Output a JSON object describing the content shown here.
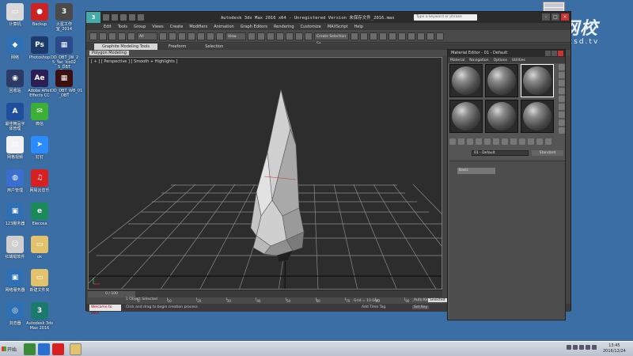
{
  "desktop": {
    "icons": [
      {
        "label": "计算机",
        "color": "#d9d9d9",
        "glyph": "▭",
        "icon": "computer-icon"
      },
      {
        "label": "Backup",
        "color": "#cc2222",
        "glyph": "●",
        "icon": "backup-icon"
      },
      {
        "label": "火星工作\n室_2014",
        "color": "#4a4a4a",
        "glyph": "3",
        "icon": "max-icon"
      },
      {
        "label": "网络",
        "color": "#2f6fb3",
        "glyph": "◆",
        "icon": "network-icon"
      },
      {
        "label": "Photoshop",
        "color": "#1c3a6b",
        "glyph": "Ps",
        "icon": "photoshop-icon"
      },
      {
        "label": "DD_DBT_JW_2\n5_Yac_Ico02\n5_DBT",
        "color": "#2a4a8a",
        "glyph": "▦",
        "icon": "image-file-icon"
      },
      {
        "label": "回收站",
        "color": "#2c3b66",
        "glyph": "◉",
        "icon": "recycle-bin-icon"
      },
      {
        "label": "Adobe After\nEffects CC",
        "color": "#2a1e55",
        "glyph": "Ae",
        "icon": "after-effects-icon"
      },
      {
        "label": "DD_DBT_WB_01\n_DBT",
        "color": "#3a1010",
        "glyph": "▦",
        "icon": "image-file-icon"
      },
      {
        "label": "最佳精品字\n体管理",
        "color": "#1f4e9c",
        "glyph": "A",
        "icon": "font-manager-icon"
      },
      {
        "label": "微信",
        "color": "#3cb034",
        "glyph": "✉",
        "icon": "wechat-icon"
      },
      {
        "label": "网格视频",
        "color": "#f2f2f2",
        "glyph": "▤",
        "icon": "document-icon"
      },
      {
        "label": "钉钉",
        "color": "#2a8cff",
        "glyph": "➤",
        "icon": "dingtalk-icon"
      },
      {
        "label": "用户管理",
        "color": "#3a6fd0",
        "glyph": "◍",
        "icon": "user-manager-icon"
      },
      {
        "label": "网易云音乐",
        "color": "#d92020",
        "glyph": "♫",
        "icon": "netease-music-icon"
      },
      {
        "label": "123服务器",
        "color": "#2f6fb3",
        "glyph": "▣",
        "icon": "server-icon"
      },
      {
        "label": "Elecosa",
        "color": "#1a8a5a",
        "glyph": "e",
        "icon": "elecosa-icon"
      },
      {
        "label": "红蜻蜓软件",
        "color": "#cfcfcf",
        "glyph": "☺",
        "icon": "software-icon"
      },
      {
        "label": "ok",
        "color": "#e2c36b",
        "glyph": "▭",
        "icon": "folder-icon"
      },
      {
        "label": "网络服务器",
        "color": "#2f6fb3",
        "glyph": "▣",
        "icon": "server-icon"
      },
      {
        "label": "新建文件夹",
        "color": "#e2c36b",
        "glyph": "▭",
        "icon": "folder-icon"
      },
      {
        "label": "浏览器",
        "color": "#2f6fb3",
        "glyph": "◎",
        "icon": "browser-icon"
      },
      {
        "label": "Autodesk 3ds\nMax 2016",
        "color": "#1b7a6e",
        "glyph": "3",
        "icon": "3dsmax-icon"
      }
    ]
  },
  "watermark": {
    "logo": "C",
    "title": "火星网校",
    "url": "www.hxsd.tv"
  },
  "window": {
    "title": "Autodesk 3ds Max  2016 x64  -  Unregistered Version   未保存文件_2016.max",
    "search_placeholder": "Type a keyword or phrase",
    "min": "–",
    "max": "□",
    "close": "×"
  },
  "menu": [
    "Edit",
    "Tools",
    "Group",
    "Views",
    "Create",
    "Modifiers",
    "Animation",
    "Graph Editors",
    "Rendering",
    "Customize",
    "MAXScript",
    "Help"
  ],
  "toolbar": {
    "selection_filter": "All",
    "view_dropdown": "View",
    "named_selection": "Create Selection Se"
  },
  "ribbon": {
    "tabs": [
      "Graphite Modeling Tools",
      "Freeform",
      "Selection"
    ],
    "active_tab": "Graphite Modeling Tools",
    "sub_label": "Polygon Modeling"
  },
  "viewport": {
    "label": "[ + ] [ Perspective ] [ Smooth + Highlights ]"
  },
  "timeline": {
    "slider": "0 / 100",
    "ticks": [
      0,
      10,
      20,
      30,
      40,
      50,
      60,
      70,
      80,
      90,
      100
    ]
  },
  "status": {
    "welcome": "Welcome to MAX:",
    "selected_count": "1 Object Selected",
    "prompt": "Click and drag to begin creation process",
    "grid": "Grid = 10.0cm",
    "add_time_tag": "Add Time Tag",
    "auto_key": "Auto Key",
    "selected": "Selected",
    "set_key": "Set Key"
  },
  "material_editor": {
    "title": "Material Editor - 01 - Default",
    "menu": [
      "Material",
      "Navigation",
      "Options",
      "Utilities"
    ],
    "material_name": "01 - Default",
    "material_type": "Standard",
    "rollout": "Basic"
  },
  "taskbar": {
    "start": "开始",
    "time": "13:45",
    "date": "2016/12/24"
  }
}
